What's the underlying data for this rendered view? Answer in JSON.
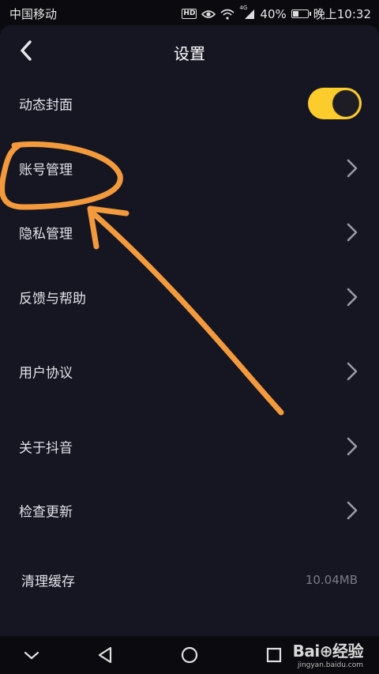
{
  "status_bar": {
    "carrier": "中国移动",
    "hd_badge": "HD",
    "network": "4G",
    "battery": "40%",
    "battery_level": 0.4,
    "time": "晚上10:32"
  },
  "header": {
    "title": "设置"
  },
  "settings": {
    "dynamic_cover": {
      "label": "动态封面",
      "enabled": true
    },
    "items": [
      {
        "label": "账号管理"
      },
      {
        "label": "隐私管理"
      },
      {
        "label": "反馈与帮助"
      },
      {
        "label": "用户协议"
      },
      {
        "label": "关于抖音"
      },
      {
        "label": "检查更新"
      }
    ],
    "clear_cache": {
      "label": "清理缓存",
      "value": "10.04MB"
    }
  },
  "colors": {
    "toggle_on": "#fccb2c",
    "annotation": "#f39a3d",
    "panel": "#161622"
  },
  "watermark": {
    "brand": "Bai⊕经验",
    "url": "jingyan.baidu.com"
  }
}
